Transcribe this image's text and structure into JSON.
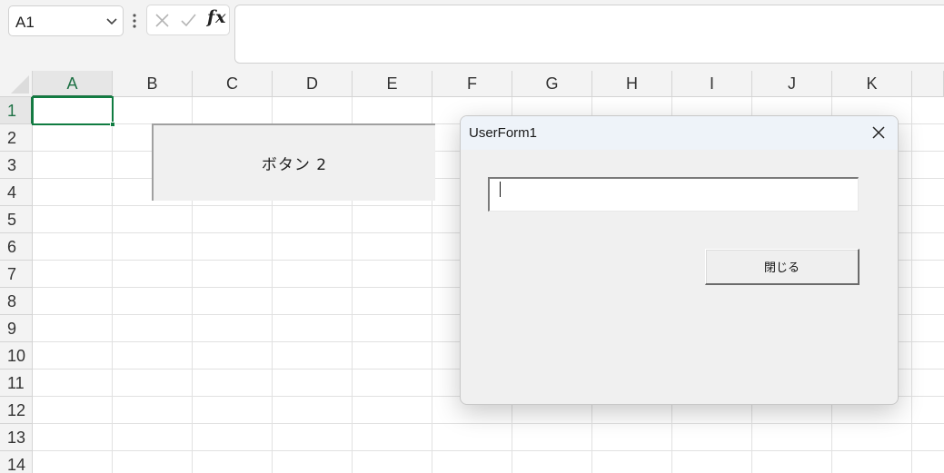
{
  "formula_bar": {
    "name_box_value": "A1",
    "cancel_icon": "x-icon",
    "enter_icon": "check-icon",
    "function_label": "fx",
    "formula_value": ""
  },
  "grid": {
    "columns": [
      "A",
      "B",
      "C",
      "D",
      "E",
      "F",
      "G",
      "H",
      "I",
      "J",
      "K"
    ],
    "rows": [
      "1",
      "2",
      "3",
      "4",
      "5",
      "6",
      "7",
      "8",
      "9",
      "10",
      "11",
      "12",
      "13",
      "14"
    ],
    "active_cell": "A1"
  },
  "sheet_button": {
    "label": "ボタン 2"
  },
  "userform": {
    "title": "UserForm1",
    "textbox_value": "",
    "close_button_label": "閉じる"
  },
  "colors": {
    "accent_green": "#107c41",
    "header_bg": "#f3f3f3",
    "gridline": "#e1e1e1",
    "dialog_bg": "#f0f0f0"
  }
}
